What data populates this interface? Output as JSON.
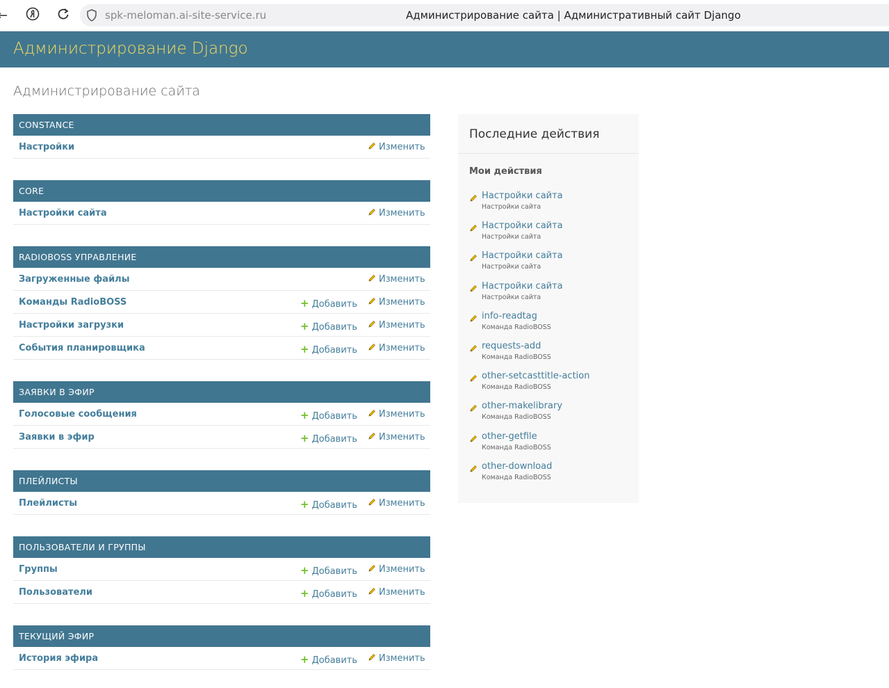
{
  "browser": {
    "url": "spk-meloman.ai-site-service.ru",
    "tab_title": "Администрирование сайта | Административный сайт Django"
  },
  "header": {
    "brand": "Администрирование Django"
  },
  "page": {
    "title": "Администрирование сайта"
  },
  "labels": {
    "add": "Добавить",
    "change": "Изменить"
  },
  "modules": [
    {
      "caption": "CONSTANCE",
      "rows": [
        {
          "name": "Настройки",
          "add": false
        }
      ]
    },
    {
      "caption": "CORE",
      "rows": [
        {
          "name": "Настройки сайта",
          "add": false
        }
      ]
    },
    {
      "caption": "RADIOBOSS УПРАВЛЕНИЕ",
      "rows": [
        {
          "name": "Загруженные файлы",
          "add": false
        },
        {
          "name": "Команды RadioBOSS",
          "add": true
        },
        {
          "name": "Настройки загрузки",
          "add": true
        },
        {
          "name": "События планировщика",
          "add": true
        }
      ]
    },
    {
      "caption": "ЗАЯВКИ В ЭФИР",
      "rows": [
        {
          "name": "Голосовые сообщения",
          "add": true
        },
        {
          "name": "Заявки в эфир",
          "add": true
        }
      ]
    },
    {
      "caption": "ПЛЕЙЛИСТЫ",
      "rows": [
        {
          "name": "Плейлисты",
          "add": true
        }
      ]
    },
    {
      "caption": "ПОЛЬЗОВАТЕЛИ И ГРУППЫ",
      "rows": [
        {
          "name": "Группы",
          "add": true
        },
        {
          "name": "Пользователи",
          "add": true
        }
      ]
    },
    {
      "caption": "ТЕКУЩИЙ ЭФИР",
      "rows": [
        {
          "name": "История эфира",
          "add": true
        }
      ]
    }
  ],
  "recent": {
    "title": "Последние действия",
    "subtitle": "Мои действия",
    "items": [
      {
        "label": "Настройки сайта",
        "type": "Настройки сайта"
      },
      {
        "label": "Настройки сайта",
        "type": "Настройки сайта"
      },
      {
        "label": "Настройки сайта",
        "type": "Настройки сайта"
      },
      {
        "label": "Настройки сайта",
        "type": "Настройки сайта"
      },
      {
        "label": "info-readtag",
        "type": "Команда RadioBOSS"
      },
      {
        "label": "requests-add",
        "type": "Команда RadioBOSS"
      },
      {
        "label": "other-setcasttitle-action",
        "type": "Команда RadioBOSS"
      },
      {
        "label": "other-makelibrary",
        "type": "Команда RadioBOSS"
      },
      {
        "label": "other-getfile",
        "type": "Команда RadioBOSS"
      },
      {
        "label": "other-download",
        "type": "Команда RadioBOSS"
      }
    ]
  },
  "colors": {
    "header_bg": "#417690",
    "brand": "#f5dd5d",
    "link": "#447e9b",
    "add_plus": "#70bf2b",
    "pencil": "#efb80b"
  }
}
